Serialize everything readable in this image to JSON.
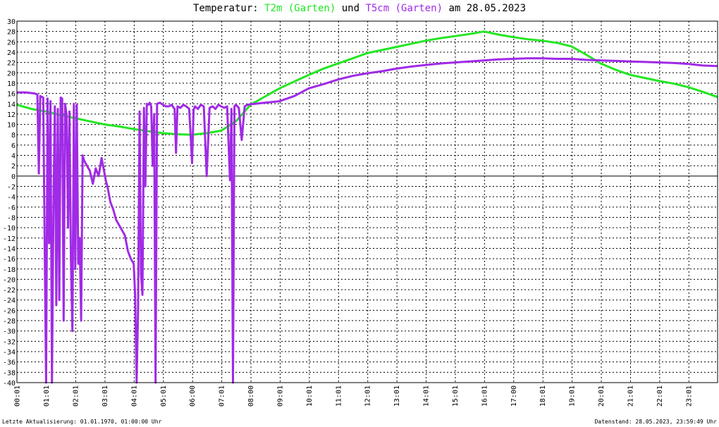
{
  "header": {
    "title_prefix": "Temperatur: ",
    "series1_label": "T2m (Garten)",
    "connector": " und ",
    "series2_label": "T5cm (Garten)",
    "title_suffix": " am 28.05.2023"
  },
  "footer": {
    "last_update": "Letzte Aktualisierung: 01.01.1970, 01:00:00 Uhr",
    "data_state": "Datenstand: 28.05.2023, 23:59:49 Uhr"
  },
  "colors": {
    "t2m": "#22e622",
    "t5cm": "#a02ae6",
    "grid": "#000000",
    "zero_line": "#000000",
    "background": "#ffffff"
  },
  "chart_data": {
    "type": "line",
    "xlabel": "",
    "ylabel": "",
    "xlim": [
      0,
      24
    ],
    "ylim": [
      -40,
      30
    ],
    "x_ticks": [
      "00:01",
      "01:01",
      "02:01",
      "03:01",
      "04:01",
      "05:01",
      "06:00",
      "07:01",
      "08:00",
      "09:01",
      "10:01",
      "11:01",
      "12:01",
      "13:01",
      "14:01",
      "15:01",
      "16:01",
      "17:00",
      "18:01",
      "19:01",
      "20:01",
      "21:01",
      "22:01",
      "23:01"
    ],
    "y_ticks": [
      30,
      28,
      26,
      24,
      22,
      20,
      18,
      16,
      14,
      12,
      10,
      8,
      6,
      4,
      2,
      0,
      -2,
      -4,
      -6,
      -8,
      -10,
      -12,
      -14,
      -16,
      -18,
      -20,
      -22,
      -24,
      -26,
      -28,
      -30,
      -32,
      -34,
      -36,
      -38,
      -40
    ],
    "y_tick_labels": [
      "30",
      "28",
      "26",
      "24",
      "22",
      "20",
      "18",
      "16",
      "14",
      "12",
      "10",
      "8",
      "6",
      "4",
      "2",
      "0",
      "-2",
      "-4",
      "-6",
      "-8",
      "-10",
      "-12",
      "-14",
      "-16",
      "-18",
      "-20",
      "-22",
      "-24",
      "-26",
      "-28",
      "-30",
      "-32",
      "-34",
      "-36",
      "-38",
      "-40"
    ],
    "grid": true,
    "series": [
      {
        "name": "T2m (Garten)",
        "x": [
          0.0,
          0.5,
          1.0,
          1.5,
          2.0,
          2.5,
          3.0,
          3.5,
          4.0,
          4.5,
          5.0,
          5.5,
          6.0,
          6.5,
          7.0,
          7.5,
          8.0,
          8.5,
          9.0,
          9.5,
          10.0,
          10.5,
          11.0,
          11.5,
          12.0,
          12.5,
          13.0,
          13.5,
          14.0,
          14.5,
          15.0,
          15.5,
          16.0,
          16.5,
          17.0,
          17.5,
          18.0,
          18.5,
          19.0,
          19.5,
          20.0,
          20.5,
          21.0,
          21.5,
          22.0,
          22.5,
          23.0,
          23.5,
          24.0
        ],
        "y": [
          13.8,
          13.0,
          12.5,
          11.8,
          11.2,
          10.6,
          10.0,
          9.6,
          9.1,
          8.7,
          8.3,
          8.1,
          8.0,
          8.3,
          8.8,
          10.6,
          13.8,
          15.4,
          17.0,
          18.3,
          19.6,
          20.8,
          21.8,
          22.8,
          23.8,
          24.4,
          25.0,
          25.6,
          26.2,
          26.7,
          27.1,
          27.5,
          28.0,
          27.4,
          26.9,
          26.5,
          26.2,
          25.8,
          25.1,
          23.5,
          21.8,
          20.6,
          19.6,
          19.0,
          18.4,
          17.9,
          17.2,
          16.3,
          15.3
        ]
      },
      {
        "name": "T5cm (Garten)",
        "x": [
          0.0,
          0.3,
          0.6,
          0.7,
          0.75,
          0.8,
          0.9,
          1.0,
          1.05,
          1.1,
          1.15,
          1.2,
          1.25,
          1.3,
          1.35,
          1.4,
          1.45,
          1.5,
          1.55,
          1.6,
          1.65,
          1.7,
          1.75,
          1.8,
          1.85,
          1.9,
          1.95,
          2.0,
          2.05,
          2.1,
          2.15,
          2.2,
          2.25,
          2.3,
          2.35,
          2.4,
          2.5,
          2.6,
          2.7,
          2.8,
          2.9,
          2.95,
          3.0,
          3.05,
          3.1,
          3.2,
          3.3,
          3.4,
          3.5,
          3.6,
          3.7,
          3.8,
          3.9,
          4.0,
          4.05,
          4.1,
          4.15,
          4.2,
          4.25,
          4.3,
          4.35,
          4.4,
          4.45,
          4.5,
          4.55,
          4.6,
          4.65,
          4.7,
          4.75,
          4.8,
          4.9,
          5.0,
          5.1,
          5.2,
          5.3,
          5.4,
          5.45,
          5.5,
          5.6,
          5.7,
          5.8,
          5.9,
          6.0,
          6.05,
          6.1,
          6.2,
          6.3,
          6.4,
          6.5,
          6.6,
          6.7,
          6.8,
          6.9,
          7.0,
          7.1,
          7.2,
          7.3,
          7.35,
          7.4,
          7.45,
          7.5,
          7.6,
          7.7,
          7.8,
          7.9,
          8.0,
          8.5,
          9.0,
          9.5,
          10.0,
          10.5,
          11.0,
          11.5,
          12.0,
          12.5,
          13.0,
          13.5,
          14.0,
          14.5,
          15.0,
          15.5,
          16.0,
          16.5,
          17.0,
          17.5,
          18.0,
          18.5,
          19.0,
          19.5,
          20.0,
          20.5,
          21.0,
          21.5,
          22.0,
          22.5,
          23.0,
          23.5,
          24.0
        ],
        "y": [
          16.2,
          16.2,
          16.0,
          15.8,
          0.5,
          15.5,
          15.2,
          -40,
          15.0,
          -13,
          14.5,
          -40,
          -6,
          13.5,
          -25,
          13.0,
          -24,
          15.2,
          15.0,
          -28,
          14.0,
          12.0,
          -10,
          12.5,
          -16,
          -30,
          14.0,
          -18,
          13.8,
          -17,
          -12,
          -28,
          4.0,
          3.0,
          2.5,
          2.0,
          1.0,
          -1.5,
          1.5,
          0.0,
          3.5,
          2.0,
          0.5,
          -1.0,
          -2.0,
          -5.0,
          -6.5,
          -8.5,
          -9.5,
          -10.5,
          -11.5,
          -14.5,
          -16.0,
          -17.0,
          -23.0,
          -40,
          -26.0,
          12.5,
          -19.0,
          -23.0,
          13.2,
          -2.0,
          14.0,
          13.8,
          14.2,
          13.5,
          2.0,
          12.0,
          -40,
          14.0,
          14.2,
          13.8,
          13.5,
          13.5,
          13.8,
          13.0,
          4.5,
          13.5,
          13.2,
          13.8,
          13.5,
          13.0,
          2.5,
          12.8,
          13.5,
          13.0,
          13.8,
          13.5,
          0.0,
          13.2,
          13.5,
          13.0,
          13.8,
          13.5,
          13.2,
          13.5,
          -0.8,
          13.0,
          -40,
          13.5,
          13.8,
          13.2,
          7.0,
          13.5,
          13.8,
          13.9,
          14.2,
          14.5,
          15.5,
          17.0,
          17.8,
          18.7,
          19.4,
          19.9,
          20.3,
          20.8,
          21.2,
          21.5,
          21.8,
          22.0,
          22.2,
          22.4,
          22.6,
          22.7,
          22.8,
          22.8,
          22.7,
          22.7,
          22.5,
          22.4,
          22.3,
          22.2,
          22.1,
          22.0,
          21.9,
          21.7,
          21.4,
          21.3
        ]
      }
    ]
  }
}
